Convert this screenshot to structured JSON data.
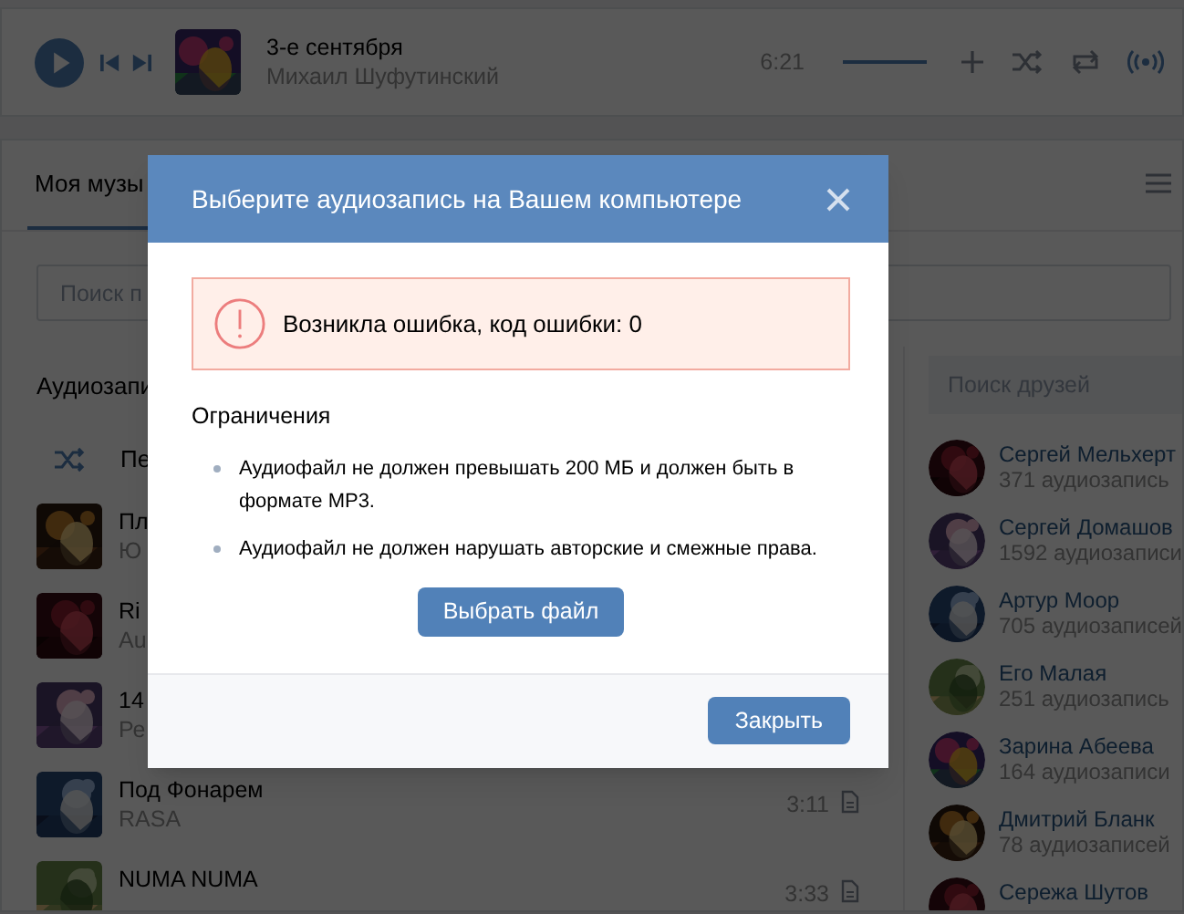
{
  "player": {
    "title": "3-е сентября",
    "artist": "Михаил Шуфутинский",
    "duration": "6:21",
    "volume": {
      "level": 1
    },
    "broadcast": {
      "on": true
    }
  },
  "tabs": [
    {
      "label": "Моя музы",
      "selected": true
    }
  ],
  "search": {
    "placeholder": "Поиск п"
  },
  "section_title": "Аудиозапи",
  "shuffle_label": "Пе",
  "tracks": [
    {
      "title": "Пл",
      "artist": "Ю"
    },
    {
      "title": "Ri",
      "artist": "Au"
    },
    {
      "title": "14",
      "artist": "Ре"
    },
    {
      "title": "Под Фонарем",
      "artist": "RASA",
      "duration": "3:11"
    },
    {
      "title": "NUMA NUMA",
      "duration": "3:33"
    }
  ],
  "friends_search": {
    "placeholder": "Поиск друзей"
  },
  "friends": [
    {
      "name": "Сергей Мельхерт",
      "count": "371 аудиозапись"
    },
    {
      "name": "Сергей Домашов",
      "count": "1592 аудиозаписи"
    },
    {
      "name": "Артур Моор",
      "count": "705 аудиозаписей"
    },
    {
      "name": "Его Малая",
      "count": "251 аудиозапись"
    },
    {
      "name": "Зарина Абеева",
      "count": "164 аудиозаписи"
    },
    {
      "name": "Дмитрий Бланк",
      "count": "78 аудиозаписей"
    },
    {
      "name": "Сережа Шутов"
    }
  ],
  "dialog": {
    "title": "Выберите аудиозапись на Вашем компьютере",
    "error": "Возникла ошибка, код ошибки: 0",
    "restrictions_title": "Ограничения",
    "restrictions": [
      "Аудиофайл не должен превышать 200 МБ и должен быть в формате MP3.",
      "Аудиофайл не должен нарушать авторские и смежные права."
    ],
    "choose_button": "Выбрать файл",
    "close_button": "Закрыть"
  }
}
